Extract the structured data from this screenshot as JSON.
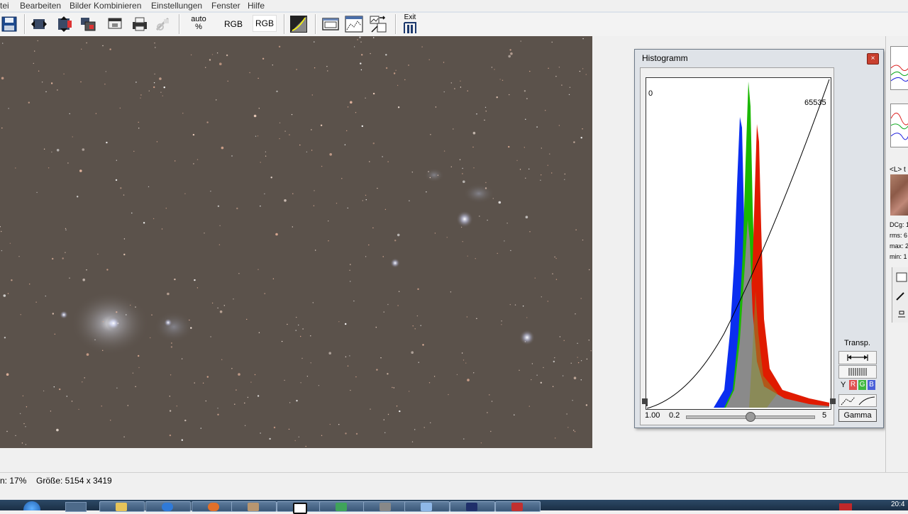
{
  "menu": {
    "items": [
      "tei",
      "Bearbeiten",
      "Bilder Kombinieren",
      "Einstellungen",
      "Fenster",
      "Hilfe"
    ]
  },
  "toolbar": {
    "auto_label_top": "auto",
    "auto_label_bottom": "%",
    "rgb_label_1": "RGB",
    "rgb_label_2": "RGB",
    "exit_label": "Exit",
    "icons": [
      "save-icon",
      "flip-horizontal-icon",
      "flip-vertical-icon",
      "layers-icon",
      "copy-window-icon",
      "print-icon",
      "disabled-tool-icon",
      "levels-icon",
      "image-window-icon",
      "image-compare-icon",
      "image-edit-icon",
      "exit-icon"
    ]
  },
  "histogram": {
    "title": "Histogramm",
    "close_label": "×",
    "label_min": "0",
    "label_max": "65535",
    "gamma_value": "1.00",
    "slider_min": "0.2",
    "slider_max": "5",
    "transp_label": "Transp.",
    "channel_y": "Y",
    "channel_r": "R",
    "channel_g": "G",
    "channel_b": "B",
    "gamma_button": "Gamma",
    "colors": {
      "red": "#e01b00",
      "green": "#1ab800",
      "blue": "#0a2ef0",
      "gray": "#8a8a8a"
    }
  },
  "rightpanel": {
    "label": "<L> t",
    "dcg": "DCg: 1",
    "rms": "rms: 6",
    "max": "max: 2",
    "min": "min: 1"
  },
  "status": {
    "zoom": "n: 17%",
    "size": "Größe: 5154 x 3419"
  },
  "taskbar": {
    "tasks": [
      "explorer",
      "folder",
      "ie",
      "firefox",
      "photo",
      "terminal",
      "network",
      "tool",
      "window",
      "astro",
      "app"
    ],
    "clock": "20:4"
  }
}
